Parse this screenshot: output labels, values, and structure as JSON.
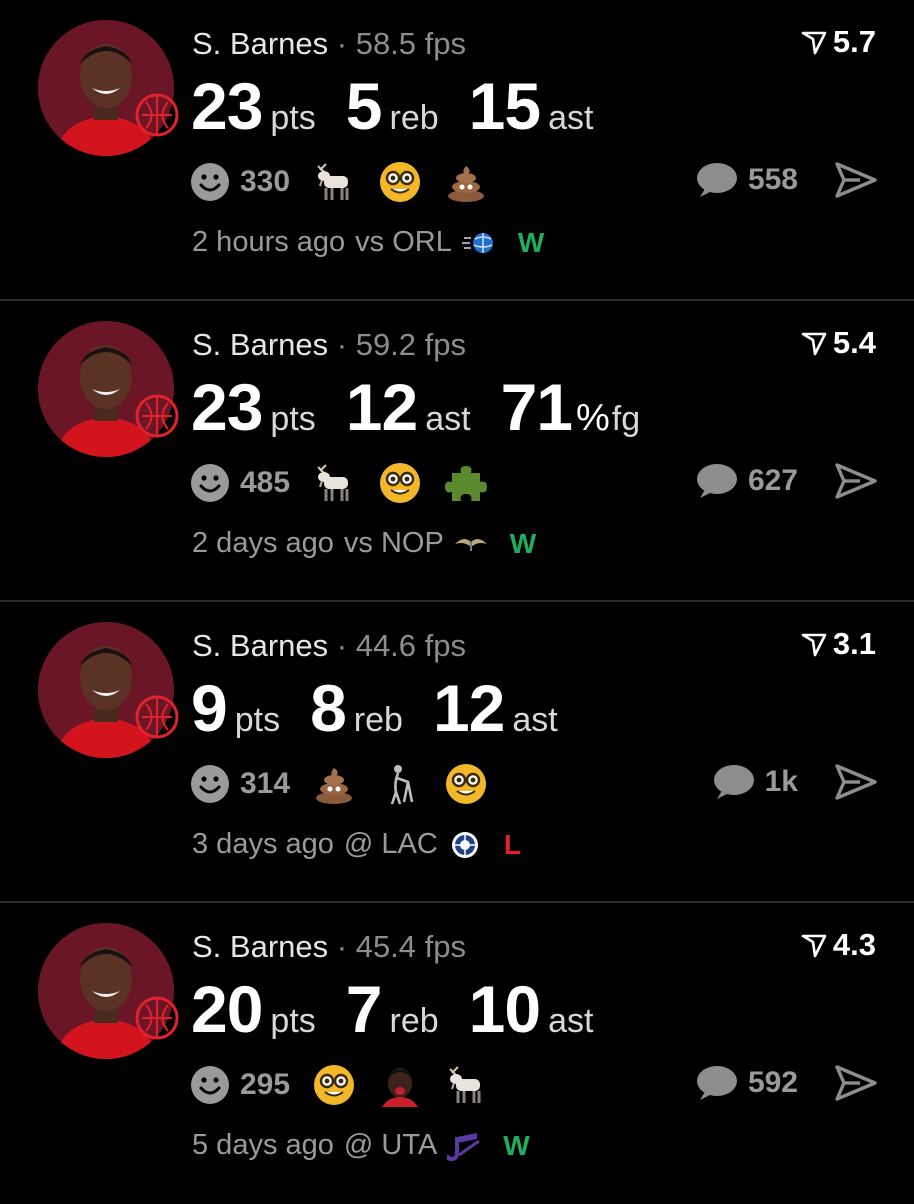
{
  "posts": [
    {
      "player": "S. Barnes",
      "separator": "·",
      "fps": "58.5 fps",
      "score": "5.7",
      "stats": [
        {
          "value": "23",
          "unit": "pts"
        },
        {
          "value": "5",
          "unit": "reb"
        },
        {
          "value": "15",
          "unit": "ast"
        }
      ],
      "reaction_count": "330",
      "emojis": [
        "goat-icon",
        "nerd-face-icon",
        "poop-icon"
      ],
      "comment_count": "558",
      "time": "2 hours ago",
      "matchup": "vs ORL",
      "opponent_logo": "magic-logo-icon",
      "result": "W"
    },
    {
      "player": "S. Barnes",
      "separator": "·",
      "fps": "59.2 fps",
      "score": "5.4",
      "stats": [
        {
          "value": "23",
          "unit": "pts"
        },
        {
          "value": "12",
          "unit": "ast"
        },
        {
          "value": "71",
          "pct": "%",
          "unit": "fg"
        }
      ],
      "reaction_count": "485",
      "emojis": [
        "goat-icon",
        "nerd-face-icon",
        "puzzle-piece-icon"
      ],
      "comment_count": "627",
      "time": "2 days ago",
      "matchup": "vs NOP",
      "opponent_logo": "pelicans-logo-icon",
      "result": "W"
    },
    {
      "player": "S. Barnes",
      "separator": "·",
      "fps": "44.6 fps",
      "score": "3.1",
      "stats": [
        {
          "value": "9",
          "unit": "pts"
        },
        {
          "value": "8",
          "unit": "reb"
        },
        {
          "value": "12",
          "unit": "ast"
        }
      ],
      "reaction_count": "314",
      "emojis": [
        "poop-icon",
        "old-man-walker-icon",
        "nerd-face-icon"
      ],
      "comment_count": "1k",
      "time": "3 days ago",
      "matchup": "@ LAC",
      "opponent_logo": "clippers-logo-icon",
      "result": "L"
    },
    {
      "player": "S. Barnes",
      "separator": "·",
      "fps": "45.4 fps",
      "score": "4.3",
      "stats": [
        {
          "value": "20",
          "unit": "pts"
        },
        {
          "value": "7",
          "unit": "reb"
        },
        {
          "value": "10",
          "unit": "ast"
        }
      ],
      "reaction_count": "295",
      "emojis": [
        "nerd-face-icon",
        "player-face-icon",
        "goat-icon"
      ],
      "comment_count": "592",
      "time": "5 days ago",
      "matchup": "@ UTA",
      "opponent_logo": "jazz-logo-icon",
      "result": "W"
    }
  ],
  "colors": {
    "background": "#000000",
    "win": "#1fae5b",
    "loss": "#e2222a",
    "muted": "#9a9a9a",
    "avatar_bg": "#6b1626"
  }
}
